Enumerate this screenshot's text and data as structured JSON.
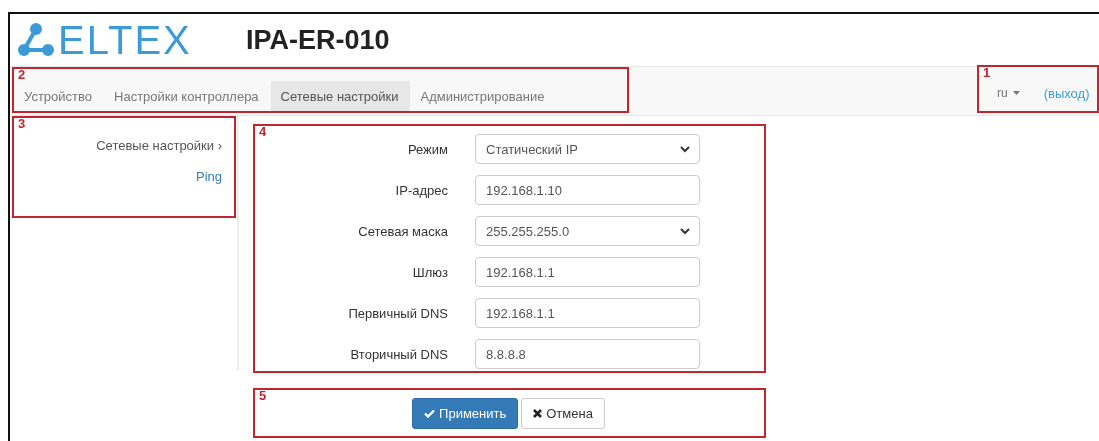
{
  "header": {
    "logo": "ELTEX",
    "title": "IPA-ER-010"
  },
  "navbar": {
    "callout": "2",
    "tabs": [
      {
        "label": "Устройство",
        "selected": false
      },
      {
        "label": "Настройки контроллера",
        "selected": false
      },
      {
        "label": "Сетевые настройки",
        "selected": true
      },
      {
        "label": "Администрирование",
        "selected": false
      }
    ]
  },
  "user_menu": {
    "callout": "1",
    "language": "ru",
    "logout": "(выход)"
  },
  "sidebar": {
    "callout": "3",
    "items": [
      {
        "label": "Сетевые настройки ›",
        "selected": true
      },
      {
        "label": "Ping",
        "selected": false
      }
    ]
  },
  "form": {
    "callout": "4",
    "fields": [
      {
        "kind": "select",
        "label": "Режим",
        "value": "Статический IP"
      },
      {
        "kind": "input",
        "label": "IP-адрес",
        "value": "192.168.1.10"
      },
      {
        "kind": "select",
        "label": "Сетевая маска",
        "value": "255.255.255.0"
      },
      {
        "kind": "input",
        "label": "Шлюз",
        "value": "192.168.1.1"
      },
      {
        "kind": "input",
        "label": "Первичный DNS",
        "value": "192.168.1.1"
      },
      {
        "kind": "input",
        "label": "Вторичный DNS",
        "value": "8.8.8.8"
      }
    ]
  },
  "actions": {
    "callout": "5",
    "buttons": [
      {
        "kind": "primary",
        "label": "Применить"
      },
      {
        "kind": "default",
        "label": "Отмена"
      }
    ]
  }
}
